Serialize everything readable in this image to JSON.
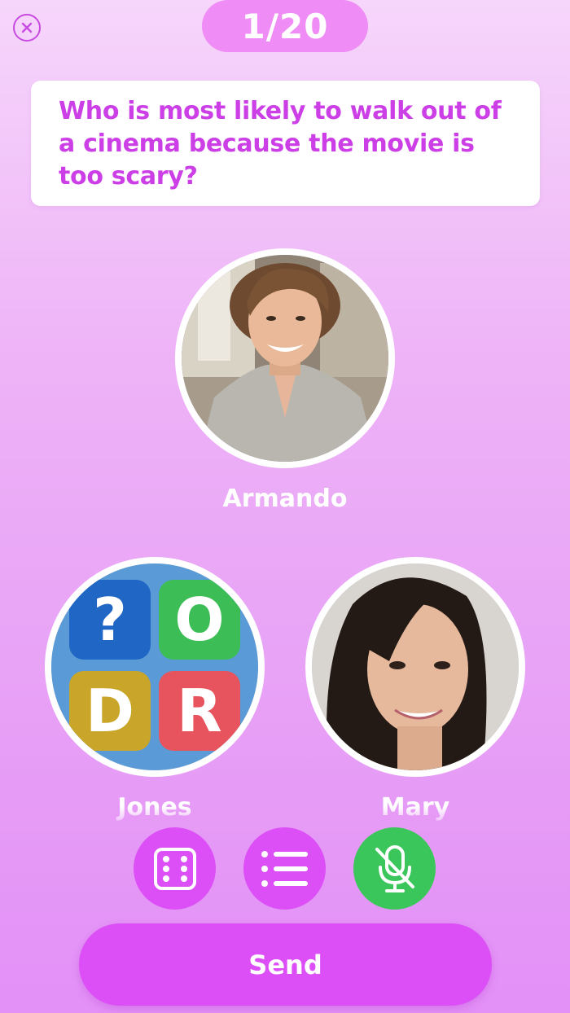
{
  "header": {
    "close_icon": "close-circle-icon",
    "counter": "1/20"
  },
  "question": {
    "text": "Who is most likely to walk out of a cinema because the movie is too scary?"
  },
  "players": [
    {
      "name": "Armando",
      "avatar": "photo-young-man"
    },
    {
      "name": "Jones",
      "avatar": "letter-tiles-icon"
    },
    {
      "name": "Mary",
      "avatar": "photo-young-woman"
    }
  ],
  "tiles": [
    "?",
    "O",
    "D",
    "R"
  ],
  "toolbar": {
    "dice_icon": "dice-icon",
    "list_icon": "list-icon",
    "mic_icon": "mic-off-icon"
  },
  "send_label": "Send",
  "colors": {
    "accent": "#dc4ff6",
    "question_text": "#cc3fe6",
    "mic_button": "#3ac65a"
  }
}
